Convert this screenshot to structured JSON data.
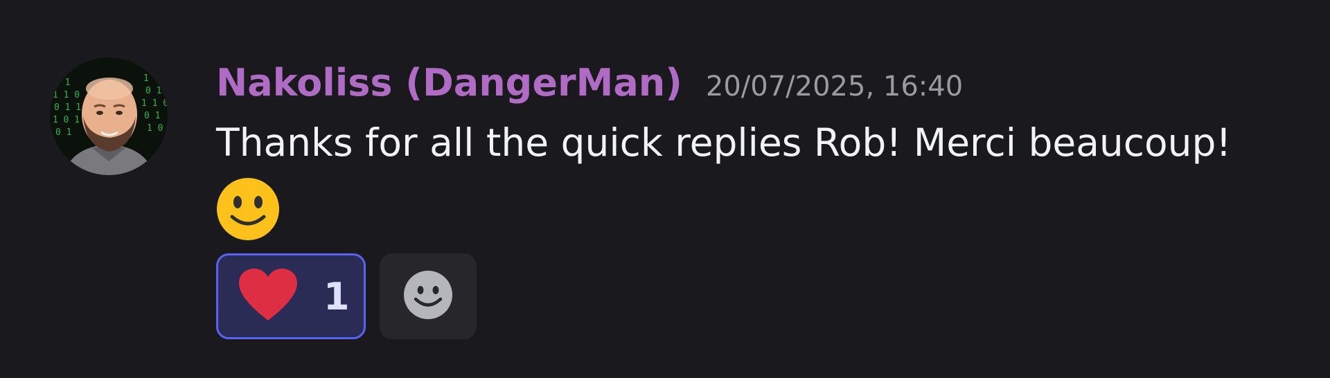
{
  "message": {
    "author": "Nakoliss (DangerMan)",
    "timestamp": "20/07/2025, 16:40",
    "text": "Thanks for all the quick replies Rob! Merci beaucoup!",
    "inline_emoji": "slightly-smiling-face",
    "reactions": [
      {
        "emoji": "red-heart",
        "count": "1",
        "reacted_by_me": true
      }
    ],
    "add_reaction_icon": "add-reaction-smiley-icon"
  },
  "colors": {
    "background": "#1a1a1e",
    "username": "#b06bc4",
    "timestamp": "#9a9aa2",
    "text": "#f2f3f5",
    "reaction_border": "#5865f2",
    "reaction_bg": "#2a2c56",
    "heart": "#dd2e44",
    "emoji_face": "#fcc21b"
  }
}
